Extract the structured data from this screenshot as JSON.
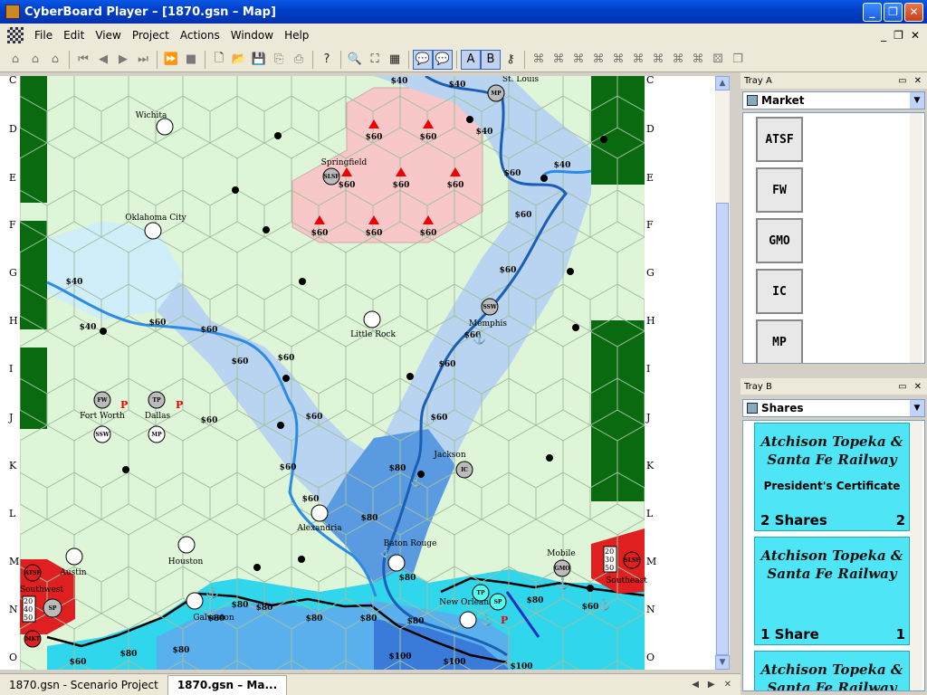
{
  "window": {
    "title": "CyberBoard Player – [1870.gsn – Map]"
  },
  "menu": {
    "items": [
      "File",
      "Edit",
      "View",
      "Project",
      "Actions",
      "Window",
      "Help"
    ]
  },
  "rows": {
    "left": [
      "C",
      "D",
      "E",
      "F",
      "G",
      "H",
      "I",
      "J",
      "K",
      "L",
      "M",
      "N",
      "O"
    ],
    "right": [
      "C",
      "D",
      "E",
      "F",
      "G",
      "H",
      "I",
      "J",
      "K",
      "L",
      "M",
      "N",
      "O"
    ]
  },
  "map": {
    "costs": [
      {
        "t": "$40",
        "name": "c1"
      },
      {
        "t": "$40",
        "name": "c2"
      },
      {
        "t": "$40",
        "name": "c3"
      },
      {
        "t": "$60",
        "name": "c4"
      },
      {
        "t": "$60",
        "name": "c5"
      },
      {
        "t": "$60",
        "name": "c6"
      },
      {
        "t": "$60",
        "name": "c7"
      },
      {
        "t": "$60",
        "name": "c8"
      },
      {
        "t": "$60",
        "name": "c9"
      },
      {
        "t": "$60",
        "name": "c10"
      },
      {
        "t": "$60",
        "name": "c11"
      },
      {
        "t": "$40",
        "name": "c12"
      },
      {
        "t": "$60",
        "name": "c13"
      },
      {
        "t": "$40",
        "name": "c14"
      },
      {
        "t": "$40",
        "name": "c15"
      },
      {
        "t": "$60",
        "name": "c16"
      },
      {
        "t": "$60",
        "name": "c17"
      },
      {
        "t": "$60",
        "name": "c18"
      },
      {
        "t": "$60",
        "name": "c19"
      },
      {
        "t": "$60",
        "name": "c20"
      },
      {
        "t": "$60",
        "name": "c21"
      },
      {
        "t": "$60",
        "name": "c22"
      },
      {
        "t": "$60",
        "name": "c23"
      },
      {
        "t": "$80",
        "name": "c24"
      },
      {
        "t": "$60",
        "name": "c25"
      },
      {
        "t": "$80",
        "name": "c26"
      },
      {
        "t": "$80",
        "name": "c27"
      },
      {
        "t": "$80",
        "name": "c28"
      },
      {
        "t": "$80",
        "name": "c29"
      },
      {
        "t": "$80",
        "name": "c30"
      },
      {
        "t": "$80",
        "name": "c31"
      },
      {
        "t": "$80",
        "name": "c32"
      },
      {
        "t": "$80",
        "name": "c33"
      },
      {
        "t": "$80",
        "name": "c34"
      },
      {
        "t": "$60",
        "name": "c35"
      },
      {
        "t": "$80",
        "name": "c36"
      },
      {
        "t": "$80",
        "name": "c37"
      },
      {
        "t": "$100",
        "name": "c38"
      },
      {
        "t": "$100",
        "name": "c39"
      },
      {
        "t": "$100",
        "name": "c40"
      },
      {
        "t": "$60",
        "name": "c41"
      },
      {
        "t": "$60",
        "name": "c42"
      },
      {
        "t": "$60",
        "name": "c43"
      },
      {
        "t": "$60",
        "name": "c44"
      },
      {
        "t": "$60",
        "name": "c45"
      }
    ],
    "cities": [
      "St. Louis",
      "Wichita",
      "Springfield",
      "Oklahoma City",
      "Memphis",
      "Little Rock",
      "Fort Worth",
      "Dallas",
      "Jackson",
      "Alexandria",
      "Baton Rouge",
      "Mobile",
      "Austin",
      "Houston",
      "Galveston",
      "New Orleans",
      "Southwest",
      "Southeast"
    ],
    "chits": [
      "MP",
      "SLSF",
      "SSW",
      "FW",
      "TP",
      "SSW",
      "MP",
      "IC",
      "GMO",
      "TP",
      "SP",
      "SP",
      "ATSF",
      "MKT",
      "SLSF"
    ],
    "pmarks": [
      "P",
      "P",
      "P"
    ],
    "sw_values": [
      "20",
      "40",
      "50"
    ],
    "se_values": [
      "20",
      "30",
      "50"
    ]
  },
  "trayA": {
    "header": "Tray A",
    "selected": "Market",
    "items": [
      "ATSF",
      "FW",
      "GMO",
      "IC",
      "MP"
    ]
  },
  "trayB": {
    "header": "Tray B",
    "selected": "Shares",
    "cards": [
      {
        "rail1": "Atchison Topeka &",
        "rail2": "Santa Fe Railway",
        "pres": "President's Certificate",
        "shares": "2 Shares",
        "n": "2"
      },
      {
        "rail1": "Atchison Topeka &",
        "rail2": "Santa Fe Railway",
        "pres": "",
        "shares": "1 Share",
        "n": "1"
      },
      {
        "rail1": "Atchison Topeka &",
        "rail2": "Santa Fe Railway",
        "pres": "",
        "shares": "",
        "n": ""
      }
    ]
  },
  "tabs": [
    "1870.gsn - Scenario Project",
    "1870.gsn – Ma..."
  ]
}
